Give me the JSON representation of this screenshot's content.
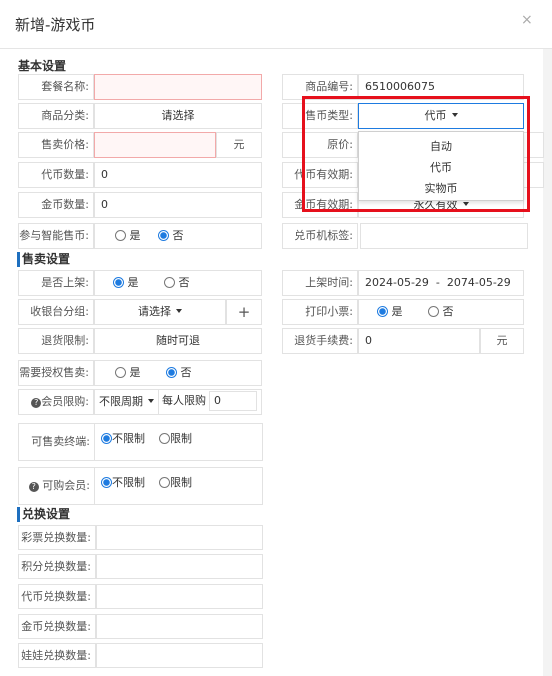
{
  "dialog": {
    "title": "新增-游戏币",
    "close_icon": "×"
  },
  "sections": {
    "basic": "基本设置",
    "sale": "售卖设置",
    "exchange": "兑换设置"
  },
  "basic": {
    "package_name": {
      "label": "套餐名称:",
      "value": ""
    },
    "product_code": {
      "label": "商品编号:",
      "value": "6510006075"
    },
    "category": {
      "label": "商品分类:",
      "value": "请选择"
    },
    "coin_type": {
      "label": "售币类型:",
      "value": "代币"
    },
    "sale_price": {
      "label": "售卖价格:",
      "value": "",
      "unit": "元"
    },
    "original_price": {
      "label": "原价:"
    },
    "token_qty": {
      "label": "代币数量:",
      "value": "0"
    },
    "token_validity": {
      "label": "代币有效期:"
    },
    "gold_qty": {
      "label": "金币数量:",
      "value": "0"
    },
    "gold_validity": {
      "label": "金币有效期:",
      "value": "永久有效"
    },
    "smart_sale": {
      "label": "参与智能售币:",
      "yes": "是",
      "no": "否",
      "selected": "no"
    },
    "kiosk_tag": {
      "label": "兑币机标签:",
      "value": ""
    }
  },
  "coin_type_dropdown": {
    "options": [
      "自动",
      "代币",
      "实物币"
    ]
  },
  "sale": {
    "on_shelf": {
      "label": "是否上架:",
      "yes": "是",
      "no": "否",
      "selected": "yes"
    },
    "shelf_time": {
      "label": "上架时间:",
      "value": "2024-05-29  -  2074-05-29"
    },
    "cashier_group": {
      "label": "收银台分组:",
      "value": "请选择",
      "add": "+"
    },
    "print_ticket": {
      "label": "打印小票:",
      "yes": "是",
      "no": "否",
      "selected": "yes"
    },
    "refund_limit": {
      "label": "退货限制:",
      "value": "随时可退"
    },
    "refund_fee": {
      "label": "退货手续费:",
      "value": "0",
      "unit": "元"
    },
    "need_auth": {
      "label": "需要授权售卖:",
      "yes": "是",
      "no": "否",
      "selected": "no"
    },
    "member_limit": {
      "label": "会员限购:",
      "period": "不限周期",
      "per_person_label": "每人限购",
      "per_person_value": "0"
    },
    "terminals": {
      "label": "可售卖终端:",
      "unlimited": "不限制",
      "limited": "限制",
      "selected": "unlimited"
    },
    "members": {
      "label": "可购会员:",
      "unlimited": "不限制",
      "limited": "限制",
      "selected": "unlimited"
    }
  },
  "exchange": {
    "rows": [
      {
        "label": "彩票兑换数量:",
        "value": ""
      },
      {
        "label": "积分兑换数量:",
        "value": ""
      },
      {
        "label": "代币兑换数量:",
        "value": ""
      },
      {
        "label": "金币兑换数量:",
        "value": ""
      },
      {
        "label": "娃娃兑换数量:",
        "value": ""
      }
    ]
  },
  "colors": {
    "accent": "#1e7be0",
    "highlight": "#e6101c",
    "error_border": "#f2a9a9"
  }
}
